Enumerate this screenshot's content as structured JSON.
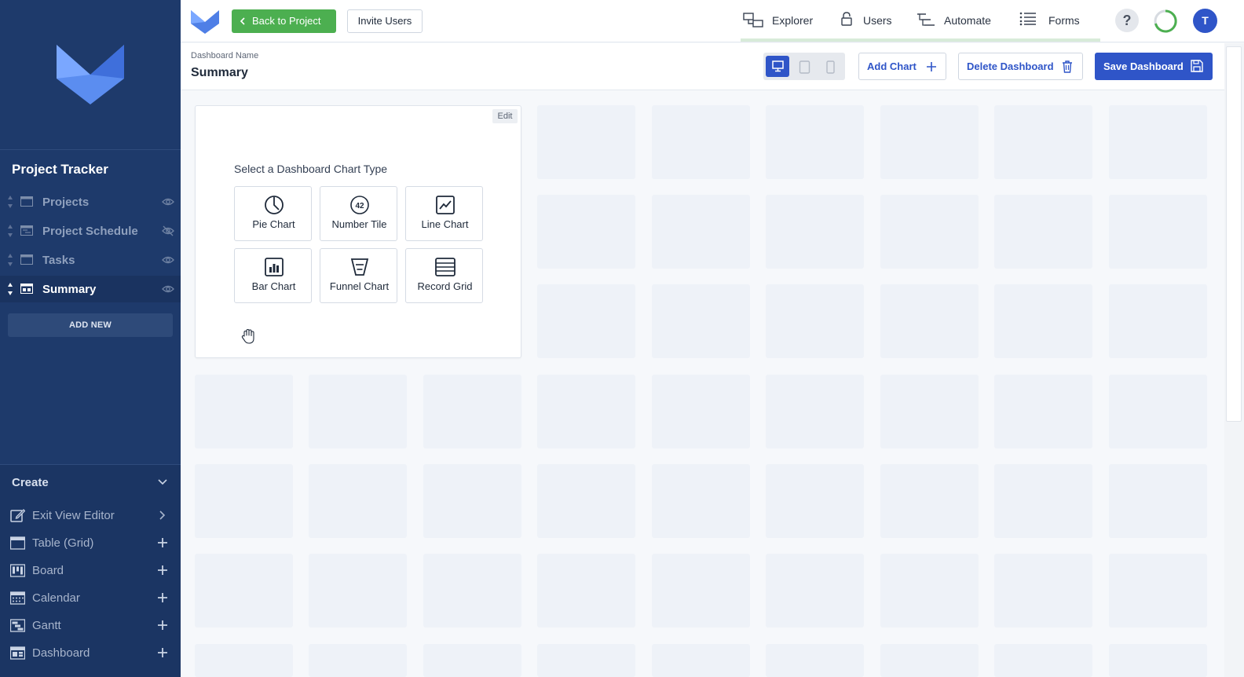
{
  "sidebar": {
    "app_title": "Project Tracker",
    "views": [
      {
        "label": "Projects",
        "active": false,
        "visibility": "eye-icon"
      },
      {
        "label": "Project Schedule",
        "active": false,
        "visibility": "eye-off-icon"
      },
      {
        "label": "Tasks",
        "active": false,
        "visibility": "eye-icon"
      },
      {
        "label": "Summary",
        "active": true,
        "visibility": "eye-icon"
      }
    ],
    "add_new_label": "ADD NEW",
    "create": {
      "heading": "Create",
      "items": [
        {
          "label": "Exit View Editor",
          "icon": "edit-icon",
          "action": "chevron-right-icon"
        },
        {
          "label": "Table (Grid)",
          "icon": "table-icon",
          "action": "plus-icon"
        },
        {
          "label": "Board",
          "icon": "board-icon",
          "action": "plus-icon"
        },
        {
          "label": "Calendar",
          "icon": "calendar-icon",
          "action": "plus-icon"
        },
        {
          "label": "Gantt",
          "icon": "gantt-icon",
          "action": "plus-icon"
        },
        {
          "label": "Dashboard",
          "icon": "dashboard-icon",
          "action": "plus-icon"
        }
      ]
    }
  },
  "topbar": {
    "back_label": "Back to Project",
    "invite_label": "Invite Users",
    "nav": [
      {
        "label": "Explorer",
        "icon": "explorer-icon"
      },
      {
        "label": "Users",
        "icon": "lock-icon"
      },
      {
        "label": "Automate",
        "icon": "automate-icon"
      },
      {
        "label": "Forms",
        "icon": "forms-icon"
      }
    ],
    "help_label": "?",
    "avatar_initial": "T"
  },
  "dashboard": {
    "name_label": "Dashboard Name",
    "name": "Summary",
    "add_chart_label": "Add Chart",
    "delete_label": "Delete Dashboard",
    "save_label": "Save Dashboard",
    "device_modes": [
      "desktop-icon",
      "tablet-icon",
      "mobile-icon"
    ],
    "active_device": "desktop-icon"
  },
  "picker": {
    "edit_label": "Edit",
    "title": "Select a Dashboard Chart Type",
    "number_tile_glyph": "42",
    "types": [
      {
        "label": "Pie Chart",
        "icon": "pie-chart-icon"
      },
      {
        "label": "Number Tile",
        "icon": "number-tile-icon"
      },
      {
        "label": "Line Chart",
        "icon": "line-chart-icon"
      },
      {
        "label": "Bar Chart",
        "icon": "bar-chart-icon"
      },
      {
        "label": "Funnel Chart",
        "icon": "funnel-chart-icon"
      },
      {
        "label": "Record Grid",
        "icon": "record-grid-icon"
      }
    ]
  },
  "colors": {
    "sidebar_bg": "#1e3a6b",
    "accent_blue": "#2f55c8",
    "back_green": "#4caf50",
    "placeholder": "#eef2f8"
  }
}
